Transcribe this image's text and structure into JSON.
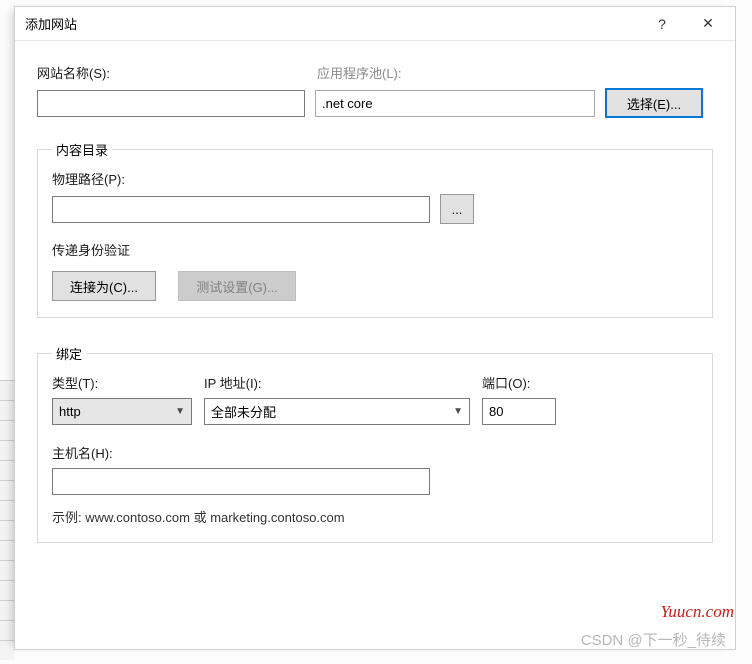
{
  "titlebar": {
    "title": "添加网站",
    "help": "?",
    "close": "✕"
  },
  "top": {
    "siteNameLabel": "网站名称(S):",
    "siteNameValue": "",
    "appPoolLabel": "应用程序池(L):",
    "appPoolValue": ".net core",
    "selectBtn": "选择(E)..."
  },
  "contentDir": {
    "legend": "内容目录",
    "physicalPathLabel": "物理路径(P):",
    "physicalPathValue": "",
    "browseBtn": "...",
    "passThroughLabel": "传递身份验证",
    "connectAsBtn": "连接为(C)...",
    "testBtn": "测试设置(G)..."
  },
  "binding": {
    "legend": "绑定",
    "typeLabel": "类型(T):",
    "typeValue": "http",
    "ipLabel": "IP 地址(I):",
    "ipValue": "全部未分配",
    "portLabel": "端口(O):",
    "portValue": "80",
    "hostLabel": "主机名(H):",
    "hostValue": "",
    "example": "示例: www.contoso.com 或 marketing.contoso.com"
  },
  "watermarks": {
    "w1": "Yuucn.com",
    "w2": "CSDN @下一秒_待续"
  }
}
